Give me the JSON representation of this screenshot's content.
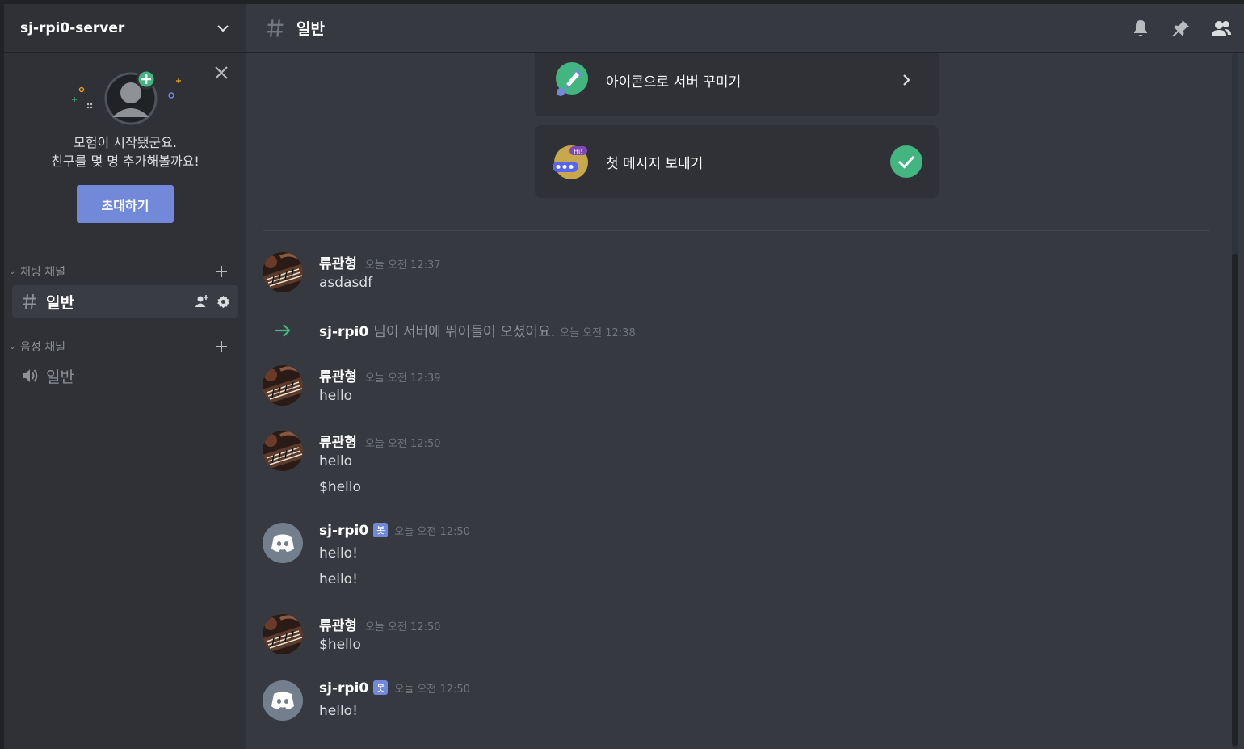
{
  "server": {
    "name": "sj-rpi0-server"
  },
  "invite": {
    "line1": "모험이 시작됐군요.",
    "line2": "친구를 몇 명 추가해볼까요!",
    "button": "초대하기"
  },
  "sidebar": {
    "categories": [
      {
        "label": "채팅 채널",
        "channels": [
          {
            "name": "일반",
            "type": "text",
            "active": true
          }
        ]
      },
      {
        "label": "음성 채널",
        "channels": [
          {
            "name": "일반",
            "type": "voice",
            "active": false
          }
        ]
      }
    ]
  },
  "channel_header": {
    "name": "일반"
  },
  "onboarding": [
    {
      "label": "아이콘으로 서버 꾸미기",
      "state": "pending"
    },
    {
      "label": "첫 메시지 보내기",
      "state": "done"
    }
  ],
  "join_notice": {
    "user": "sj-rpi0",
    "text": "님이 서버에 뛰어들어 오셨어요.",
    "time": "오늘 오전 12:38"
  },
  "messages": [
    {
      "author": "류관형",
      "bot": false,
      "time": "오늘 오전 12:37",
      "lines": [
        "asdasdf"
      ]
    },
    {
      "author": "류관형",
      "bot": false,
      "time": "오늘 오전 12:39",
      "lines": [
        "hello"
      ]
    },
    {
      "author": "류관형",
      "bot": false,
      "time": "오늘 오전 12:50",
      "lines": [
        "hello",
        "$hello"
      ]
    },
    {
      "author": "sj-rpi0",
      "bot": true,
      "bot_tag": "봇",
      "time": "오늘 오전 12:50",
      "lines": [
        "hello!",
        "hello!"
      ]
    },
    {
      "author": "류관형",
      "bot": false,
      "time": "오늘 오전 12:50",
      "lines": [
        "$hello"
      ]
    },
    {
      "author": "sj-rpi0",
      "bot": true,
      "bot_tag": "봇",
      "time": "오늘 오전 12:50",
      "lines": [
        "hello!"
      ]
    }
  ],
  "colors": {
    "accent": "#7289da",
    "success": "#43b581",
    "sidebar_bg": "#2f3136",
    "main_bg": "#36393f"
  },
  "icons": {
    "server_menu": "chevron-down-icon",
    "close": "close-icon",
    "text_channel": "hash-icon",
    "voice_channel": "speaker-icon",
    "add": "plus-icon",
    "invite_member": "add-member-icon",
    "settings": "gear-icon",
    "notifications": "bell-icon",
    "pins": "pin-icon",
    "members": "members-icon",
    "join_arrow": "arrow-right-icon",
    "card_chevron": "chevron-right-icon",
    "card_done": "checkmark-icon"
  }
}
